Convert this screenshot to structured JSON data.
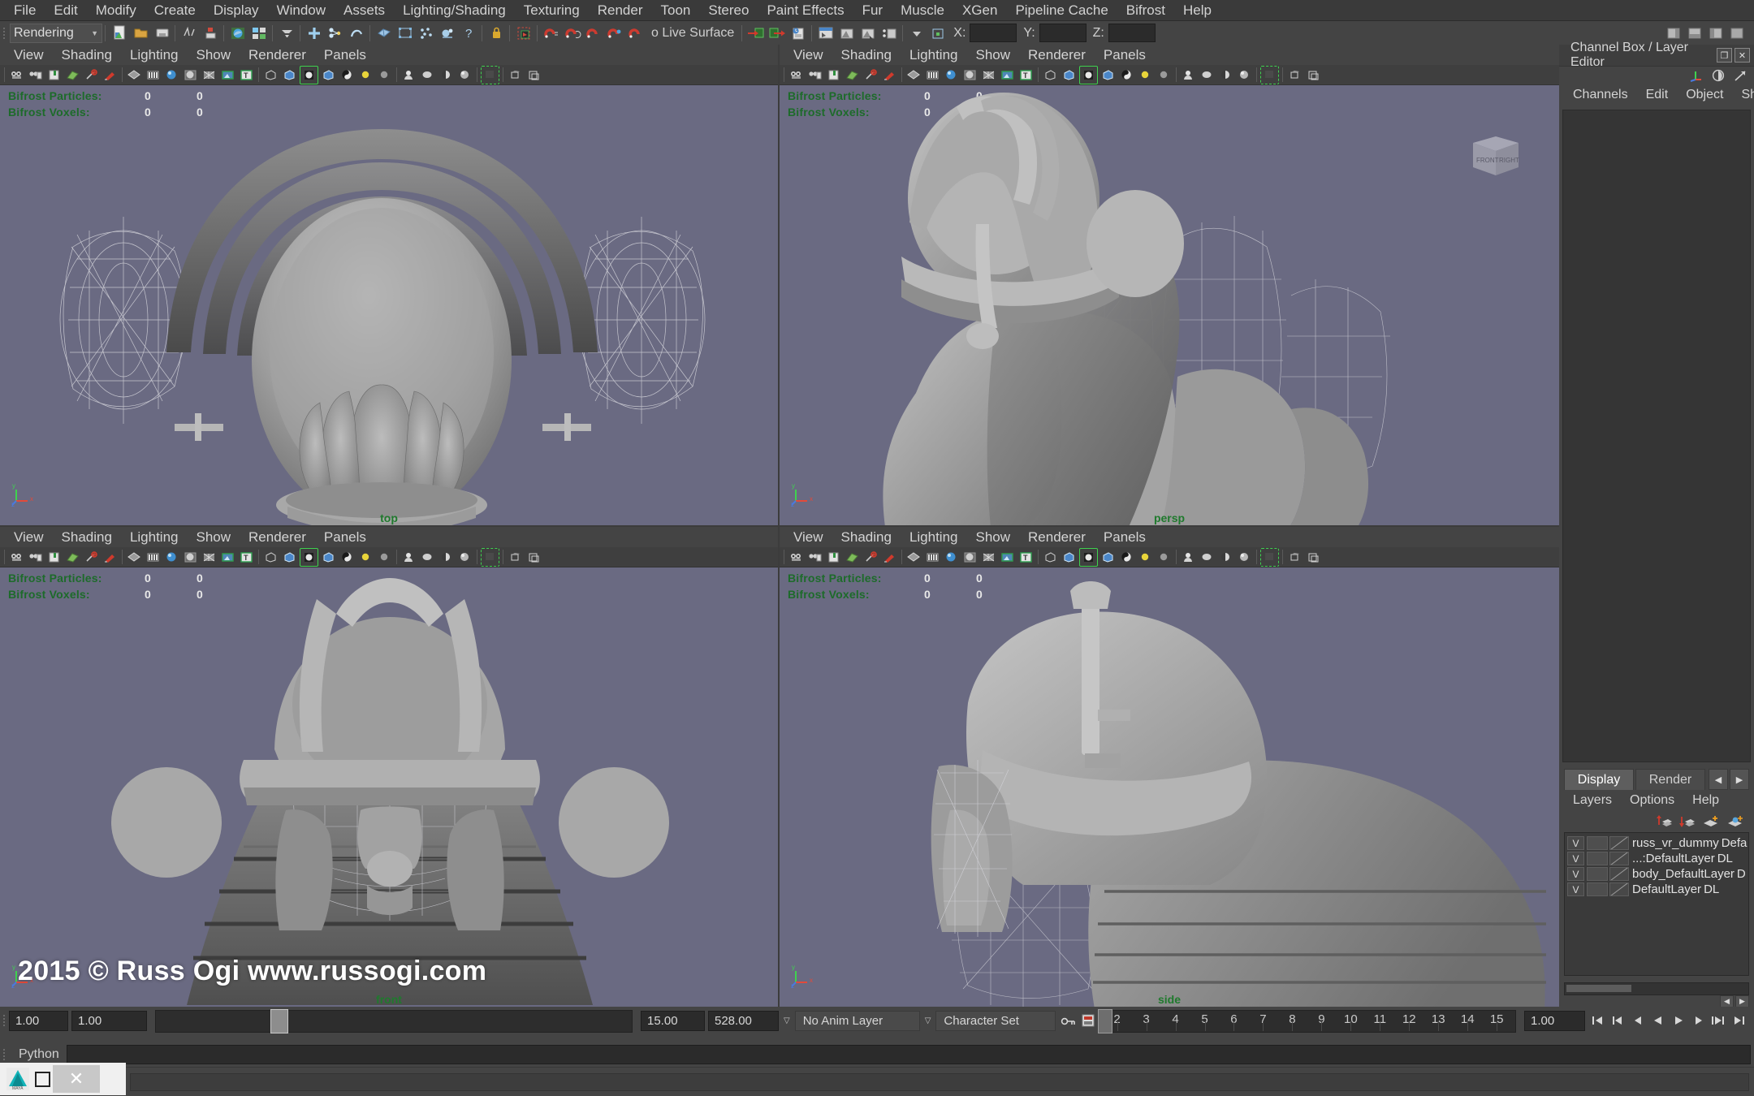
{
  "app": {
    "title": "Autodesk Maya",
    "menu_mode": "Rendering"
  },
  "menubar": {
    "items": [
      "File",
      "Edit",
      "Modify",
      "Create",
      "Display",
      "Window",
      "Assets",
      "Lighting/Shading",
      "Texturing",
      "Render",
      "Toon",
      "Stereo",
      "Paint Effects",
      "Fur",
      "Muscle",
      "XGen",
      "Pipeline Cache",
      "Bifrost",
      "Help"
    ]
  },
  "statusline": {
    "mode_selector": "Rendering",
    "live_surface_label": "o Live Surface",
    "coord_x_label": "X:",
    "coord_y_label": "Y:",
    "coord_z_label": "Z:",
    "coord_x_value": "",
    "coord_y_value": "",
    "coord_z_value": "",
    "icons": [
      "new-scene-icon",
      "open-scene-icon",
      "save-scene-icon",
      "undo-icon",
      "redo-icon",
      "render-view-icon",
      "render-settings-icon",
      "hypershade-icon",
      "select-by-hierarchy-icon",
      "select-by-object-icon",
      "select-by-component-icon",
      "select-mask-surface-icon",
      "select-mask-deformation-icon",
      "select-mask-dynamic-icon",
      "select-mask-rendering-icon",
      "select-mask-misc-icon",
      "lock-icon",
      "snap-grid-icon",
      "snap-curve-icon",
      "snap-point-icon",
      "snap-view-plane-icon",
      "snap-live-icon",
      "construction-history-icon",
      "render-current-frame-icon",
      "ipr-render-icon",
      "render-settings-open-icon",
      "show-editor-icon",
      "input-connections-icon",
      "output-connections-icon",
      "numeric-input-icon"
    ]
  },
  "viewports": [
    {
      "id": "top",
      "label": "top",
      "menus": [
        "View",
        "Shading",
        "Lighting",
        "Show",
        "Renderer",
        "Panels"
      ],
      "hud": [
        {
          "label": "Bifrost Particles:",
          "v1": "0",
          "v2": "0"
        },
        {
          "label": "Bifrost Voxels:",
          "v1": "0",
          "v2": "0"
        }
      ]
    },
    {
      "id": "persp",
      "label": "persp",
      "menus": [
        "View",
        "Shading",
        "Lighting",
        "Show",
        "Renderer",
        "Panels"
      ],
      "hud": [
        {
          "label": "Bifrost Particles:",
          "v1": "0",
          "v2": "0"
        },
        {
          "label": "Bifrost Voxels:",
          "v1": "0",
          "v2": "0"
        }
      ],
      "viewcube": {
        "front_face": "FRONT",
        "right_face": "RIGHT"
      }
    },
    {
      "id": "front",
      "label": "front",
      "menus": [
        "View",
        "Shading",
        "Lighting",
        "Show",
        "Renderer",
        "Panels"
      ],
      "hud": [
        {
          "label": "Bifrost Particles:",
          "v1": "0",
          "v2": "0"
        },
        {
          "label": "Bifrost Voxels:",
          "v1": "0",
          "v2": "0"
        }
      ]
    },
    {
      "id": "side",
      "label": "side",
      "menus": [
        "View",
        "Shading",
        "Lighting",
        "Show",
        "Renderer",
        "Panels"
      ],
      "hud": [
        {
          "label": "Bifrost Particles:",
          "v1": "0",
          "v2": "0"
        },
        {
          "label": "Bifrost Voxels:",
          "v1": "0",
          "v2": "0"
        }
      ]
    }
  ],
  "viewport_toolbar_icons": [
    "select-camera-icon",
    "camera-attributes-icon",
    "bookmarks-icon",
    "image-plane-icon",
    "keyframe-icon",
    "paint-icon",
    "wireframe-icon",
    "wireframe-on-shaded-icon",
    "smooth-shade-icon",
    "flat-shade-icon",
    "texture-border-icon",
    "hardware-texturing-icon",
    "text-display-icon",
    "xray-icon",
    "xray-joints-icon",
    "shadows-icon",
    "xray-active-icon",
    "occlusion-icon",
    "light-icon",
    "default-light-icon",
    "all-lights-icon",
    "grid-icon",
    "film-gate-icon",
    "resolution-gate-icon",
    "gate-mask-icon",
    "isolate-select-icon",
    "snap-objects-icon",
    "exposure-icon",
    "gamma-icon"
  ],
  "channel_box": {
    "title": "Channel Box / Layer Editor",
    "window_buttons": [
      "undock-icon",
      "close-icon"
    ],
    "header_icons": [
      "channel-box-icon",
      "attribute-editor-icon",
      "tool-settings-icon"
    ],
    "menus": [
      "Channels",
      "Edit",
      "Object",
      "Show"
    ],
    "content": ""
  },
  "layer_editor": {
    "tabs": [
      {
        "label": "Display",
        "active": true
      },
      {
        "label": "Render",
        "active": false
      }
    ],
    "nav_buttons": [
      "prev-tab-icon",
      "next-tab-icon"
    ],
    "menus": [
      "Layers",
      "Options",
      "Help"
    ],
    "toolbar_icons": [
      "move-layer-up-icon",
      "move-layer-down-icon",
      "new-layer-icon",
      "new-layer-from-selected-icon"
    ],
    "columns": [
      "visibility",
      "color",
      "shading",
      "name"
    ],
    "rows": [
      {
        "visible": "V",
        "name": "russ_vr_dummy",
        "extra": "Defa"
      },
      {
        "visible": "V",
        "name": "...:DefaultLayer",
        "extra": "DL"
      },
      {
        "visible": "V",
        "name": "body_DefaultLayer",
        "extra": "D"
      },
      {
        "visible": "V",
        "name": "DefaultLayer",
        "extra": "DL"
      }
    ]
  },
  "time_slider": {
    "range_start": "1.00",
    "anim_start": "1.00",
    "anim_end": "15.00",
    "range_end": "528.00",
    "anim_layer": "No Anim Layer",
    "character_set": "Character Set",
    "current_frame": "1",
    "playback_speed": "1.00",
    "frame_ticks": [
      "2",
      "3",
      "4",
      "5",
      "6",
      "7",
      "8",
      "9",
      "10",
      "11",
      "12",
      "13",
      "14",
      "15"
    ],
    "playback_buttons": [
      "go-to-start-icon",
      "step-back-key-icon",
      "step-back-frame-icon",
      "play-backwards-icon",
      "play-forwards-icon",
      "step-forward-frame-icon",
      "step-forward-key-icon",
      "go-to-end-icon"
    ],
    "extra_buttons": [
      "auto-key-icon",
      "animation-preferences-icon"
    ]
  },
  "command_line": {
    "language_label": "Python",
    "input_value": "",
    "result_value": ""
  },
  "watermark": {
    "text": "2015 © Russ Ogi   www.russogi.com"
  },
  "taskbar": {
    "items": [
      "maya-app-icon",
      "restore-window-icon",
      "close-window-icon"
    ],
    "close_label": "✕"
  },
  "colors": {
    "viewport_bg": "#6a6a82",
    "chrome_bg": "#444444",
    "hud_green": "#1d6b2a",
    "panel_dark": "#353535",
    "mesh_light": "#b9b9b9",
    "mesh_mid": "#8d8d8d",
    "mesh_dark": "#3a3a3a",
    "wireframe": "#d8d8dd"
  }
}
